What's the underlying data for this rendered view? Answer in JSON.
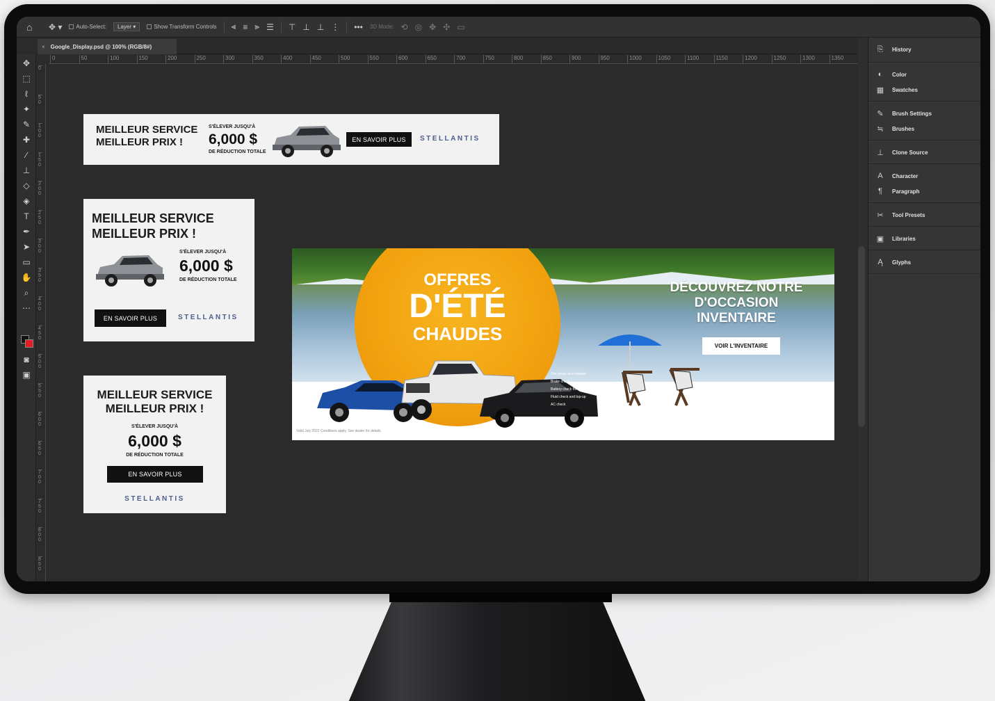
{
  "options_bar": {
    "auto_select_label": "Auto-Select:",
    "auto_select_value": "Layer",
    "show_transform_label": "Show Transform Controls",
    "mode_label": "3D Mode:"
  },
  "document": {
    "tab_title": "Google_Display.psd @ 100% (RGB/8#)",
    "close_glyph": "×"
  },
  "ruler": {
    "horizontal": [
      "0",
      "50",
      "100",
      "150",
      "200",
      "250",
      "300",
      "350",
      "400",
      "450",
      "500",
      "550",
      "600",
      "650",
      "700",
      "750",
      "800",
      "850",
      "900",
      "950",
      "1000",
      "1050",
      "1100",
      "1150",
      "1200",
      "1250",
      "1300",
      "1350"
    ],
    "vertical": [
      "0",
      "50",
      "100",
      "150",
      "200",
      "250",
      "300",
      "350",
      "400",
      "450",
      "500",
      "550",
      "600",
      "650",
      "700",
      "750",
      "800",
      "850",
      "900",
      "950",
      "1000",
      "1050"
    ]
  },
  "panels": {
    "groups": [
      [
        "History"
      ],
      [
        "Color",
        "Swatches"
      ],
      [
        "Brush Settings",
        "Brushes"
      ],
      [
        "Clone Source"
      ],
      [
        "Character",
        "Paragraph"
      ],
      [
        "Tool Presets"
      ],
      [
        "Libraries"
      ],
      [
        "Glyphs"
      ]
    ]
  },
  "banner_wide": {
    "line1": "MEILLEUR SERVICE",
    "line2": "MEILLEUR PRIX !",
    "up_to": "S'ÉLEVER JUSQU'À",
    "price": "6,000 $",
    "reduction": "DE RÉDUCTION TOTALE",
    "cta": "EN SAVOIR PLUS",
    "logo": "STELLANTIS"
  },
  "banner_medium": {
    "line1": "MEILLEUR SERVICE",
    "line2": "MEILLEUR PRIX !",
    "up_to": "S'ÉLEVER JUSQU'À",
    "price": "6,000 $",
    "reduction": "DE RÉDUCTION TOTALE",
    "cta": "EN SAVOIR PLUS",
    "logo": "STELLANTIS"
  },
  "banner_small": {
    "line1": "MEILLEUR SERVICE",
    "line2": "MEILLEUR PRIX !",
    "up_to": "S'ÉLEVER JUSQU'À",
    "price": "6,000 $",
    "reduction": "DE RÉDUCTION TOTALE",
    "cta": "EN SAVOIR PLUS",
    "logo": "STELLANTIS"
  },
  "hero": {
    "offer_l1": "OFFRES",
    "offer_l2": "D'ÉTÉ",
    "offer_l3": "CHAUDES",
    "headline": "DÉCOUVREZ NOTRE D'OCCASION INVENTAIRE",
    "cta": "VOIR L'INVENTAIRE",
    "legal": "Valid July 2022 Conditions apply. See dealer for details.",
    "features": [
      "Tire check and rotation",
      "Brake check",
      "Battery check for charge",
      "Fluid check and top-up",
      "AC check"
    ]
  },
  "colors": {
    "app_bg": "#2b2b2b",
    "accent_orange": "#f2a10e",
    "stellantis_blue": "#4c5d8c",
    "fg_swatch": "#111111",
    "bg_swatch": "#e31b23"
  }
}
